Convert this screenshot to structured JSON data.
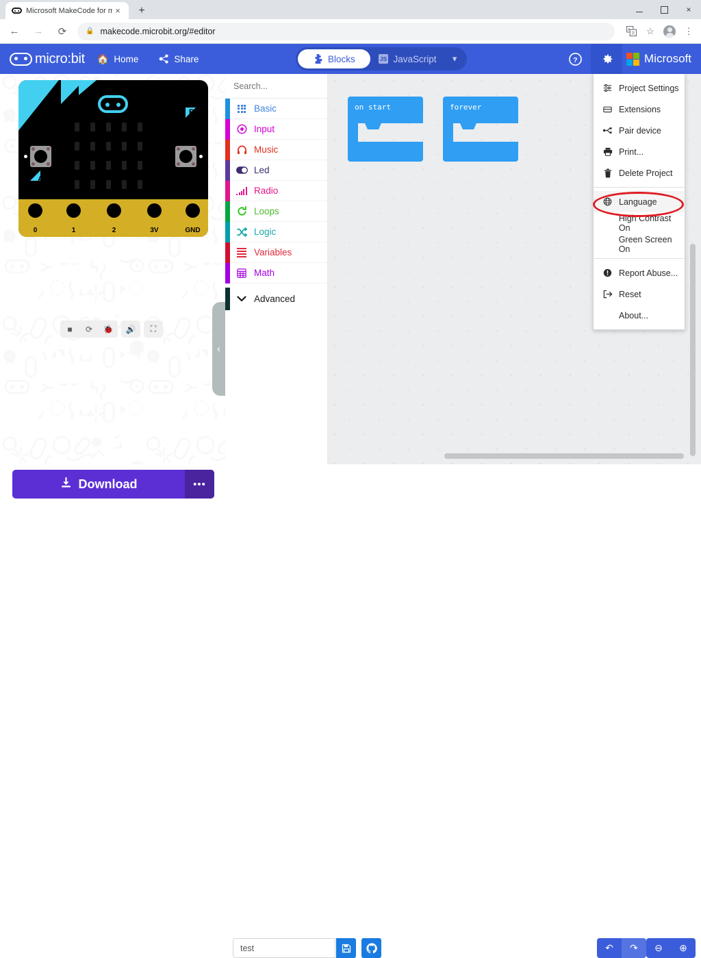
{
  "browser": {
    "tab": {
      "title": "Microsoft MakeCode for microbi",
      "favicon": "microbit-icon",
      "close": "×"
    },
    "new_tab": "+",
    "window_controls": {
      "minimize": "minimize-icon",
      "maximize": "maximize-icon",
      "close": "×"
    },
    "nav": {
      "back": "←",
      "forward": "→",
      "reload": "⟳"
    },
    "omnibox": {
      "lock": "🔒",
      "url": "makecode.microbit.org/#editor"
    },
    "actions": {
      "translate": "translate-icon",
      "bookmark": "☆",
      "profile": "avatar-icon",
      "menu": "⋮"
    }
  },
  "header": {
    "logo_text": "micro:bit",
    "home_label": "Home",
    "share_label": "Share",
    "toggle": {
      "blocks_label": "Blocks",
      "javascript_label": "JavaScript",
      "js_badge": "JS",
      "chevron": "▾"
    },
    "help_icon": "?",
    "gear_icon": "⚙",
    "microsoft_label": "Microsoft",
    "colors": {
      "header_bg": "#3b5ddb",
      "toggle_bg": "#2e4dbd",
      "accent_blue": "#1a7ce0"
    }
  },
  "gear_menu": {
    "groups": [
      [
        {
          "label": "Project Settings",
          "icon": "sliders-icon"
        },
        {
          "label": "Extensions",
          "icon": "extensions-icon"
        },
        {
          "label": "Pair device",
          "icon": "usb-icon"
        },
        {
          "label": "Print...",
          "icon": "printer-icon"
        },
        {
          "label": "Delete Project",
          "icon": "trash-icon"
        }
      ],
      [
        {
          "label": "Language",
          "icon": "globe-icon",
          "highlighted": true
        },
        {
          "label": "High Contrast On",
          "icon": ""
        },
        {
          "label": "Green Screen On",
          "icon": ""
        }
      ],
      [
        {
          "label": "Report Abuse...",
          "icon": "info-icon"
        },
        {
          "label": "Reset",
          "icon": "reset-icon"
        },
        {
          "label": "About...",
          "icon": ""
        }
      ]
    ],
    "annotation": {
      "shape": "ellipse",
      "target": "Language",
      "color": "#e01b22"
    }
  },
  "simulator": {
    "device": "micro:bit",
    "pin_labels": [
      "0",
      "1",
      "2",
      "3V",
      "GND"
    ],
    "button_labels": [
      "A",
      "B"
    ],
    "controls": [
      {
        "name": "stop-button",
        "icon": "■"
      },
      {
        "name": "restart-button",
        "icon": "⟳"
      },
      {
        "name": "debug-button",
        "icon": "🐞"
      },
      {
        "name": "mute-button",
        "icon": "🔊"
      },
      {
        "name": "fullscreen-button",
        "icon": "⛶"
      }
    ],
    "collapse_icon": "‹"
  },
  "toolbox": {
    "search_placeholder": "Search...",
    "search_value": "",
    "search_icon": "⌕",
    "categories": [
      {
        "label": "Basic",
        "color": "#1e90e0",
        "text_color": "#4186e0",
        "icon": "grid-icon"
      },
      {
        "label": "Input",
        "color": "#d400d4",
        "text_color": "#d400d4",
        "icon": "target-icon"
      },
      {
        "label": "Music",
        "color": "#e0301e",
        "text_color": "#e0301e",
        "icon": "headphone-icon"
      },
      {
        "label": "Led",
        "color": "#5b3a9e",
        "text_color": "#3d2d70",
        "icon": "toggle-icon"
      },
      {
        "label": "Radio",
        "color": "#e1158b",
        "text_color": "#e1158b",
        "icon": "signal-icon"
      },
      {
        "label": "Loops",
        "color": "#00a63f",
        "text_color": "#4dbb2e",
        "icon": "refresh-icon"
      },
      {
        "label": "Logic",
        "color": "#00a0a8",
        "text_color": "#1aa8a8",
        "icon": "shuffle-icon"
      },
      {
        "label": "Variables",
        "color": "#d01030",
        "text_color": "#e02a3c",
        "icon": "lines-icon"
      },
      {
        "label": "Math",
        "color": "#a300e0",
        "text_color": "#a300e0",
        "icon": "calculator-icon"
      }
    ],
    "advanced": {
      "label": "Advanced",
      "color": "#0d3030",
      "chevron": "⌄"
    }
  },
  "workspace": {
    "blocks": [
      {
        "label": "on start"
      },
      {
        "label": "forever"
      }
    ],
    "block_color": "#2f9ef3"
  },
  "bottom": {
    "download_label": "Download",
    "download_icon": "⬇",
    "more_icon": "•••",
    "project_name": "test",
    "project_placeholder": "",
    "save_icon": "💾",
    "github_icon": "Ⓖ",
    "undo_icon": "↶",
    "redo_icon": "↷",
    "zoom_out_icon": "⊖",
    "zoom_in_icon": "⊕"
  }
}
